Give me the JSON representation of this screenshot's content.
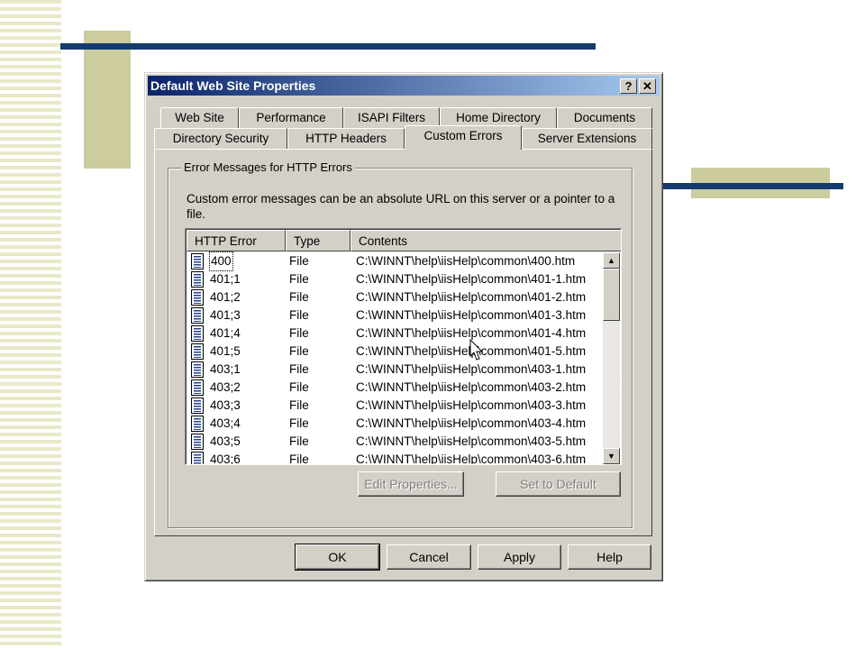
{
  "dialog": {
    "title": "Default Web Site Properties",
    "help_button": "?",
    "close_button": "✕"
  },
  "tabs": {
    "row1": [
      "Web Site",
      "Performance",
      "ISAPI Filters",
      "Home Directory",
      "Documents"
    ],
    "row2": [
      "Directory Security",
      "HTTP Headers",
      "Custom Errors",
      "Server Extensions"
    ],
    "active": "Custom Errors"
  },
  "group": {
    "label": "Error Messages for HTTP Errors",
    "description": "Custom error messages can be an absolute URL on this server or a pointer to a file."
  },
  "list": {
    "columns": [
      "HTTP Error",
      "Type",
      "Contents"
    ],
    "rows": [
      {
        "error": "400",
        "type": "File",
        "contents": "C:\\WINNT\\help\\iisHelp\\common\\400.htm"
      },
      {
        "error": "401;1",
        "type": "File",
        "contents": "C:\\WINNT\\help\\iisHelp\\common\\401-1.htm"
      },
      {
        "error": "401;2",
        "type": "File",
        "contents": "C:\\WINNT\\help\\iisHelp\\common\\401-2.htm"
      },
      {
        "error": "401;3",
        "type": "File",
        "contents": "C:\\WINNT\\help\\iisHelp\\common\\401-3.htm"
      },
      {
        "error": "401;4",
        "type": "File",
        "contents": "C:\\WINNT\\help\\iisHelp\\common\\401-4.htm"
      },
      {
        "error": "401;5",
        "type": "File",
        "contents": "C:\\WINNT\\help\\iisHelp\\common\\401-5.htm"
      },
      {
        "error": "403;1",
        "type": "File",
        "contents": "C:\\WINNT\\help\\iisHelp\\common\\403-1.htm"
      },
      {
        "error": "403;2",
        "type": "File",
        "contents": "C:\\WINNT\\help\\iisHelp\\common\\403-2.htm"
      },
      {
        "error": "403;3",
        "type": "File",
        "contents": "C:\\WINNT\\help\\iisHelp\\common\\403-3.htm"
      },
      {
        "error": "403;4",
        "type": "File",
        "contents": "C:\\WINNT\\help\\iisHelp\\common\\403-4.htm"
      },
      {
        "error": "403;5",
        "type": "File",
        "contents": "C:\\WINNT\\help\\iisHelp\\common\\403-5.htm"
      },
      {
        "error": "403;6",
        "type": "File",
        "contents": "C:\\WINNT\\help\\iisHelp\\common\\403-6.htm"
      }
    ]
  },
  "actions": {
    "edit_properties": "Edit Properties...",
    "set_to_default": "Set to Default"
  },
  "footer": {
    "ok": "OK",
    "cancel": "Cancel",
    "apply": "Apply",
    "help": "Help"
  },
  "colors": {
    "title_bar_start": "#0a246a",
    "title_bar_end": "#a6caf0",
    "dialog_face": "#d4d0c8",
    "slide_accent_navy": "#153a6e",
    "slide_accent_khaki": "#cccc9e"
  }
}
